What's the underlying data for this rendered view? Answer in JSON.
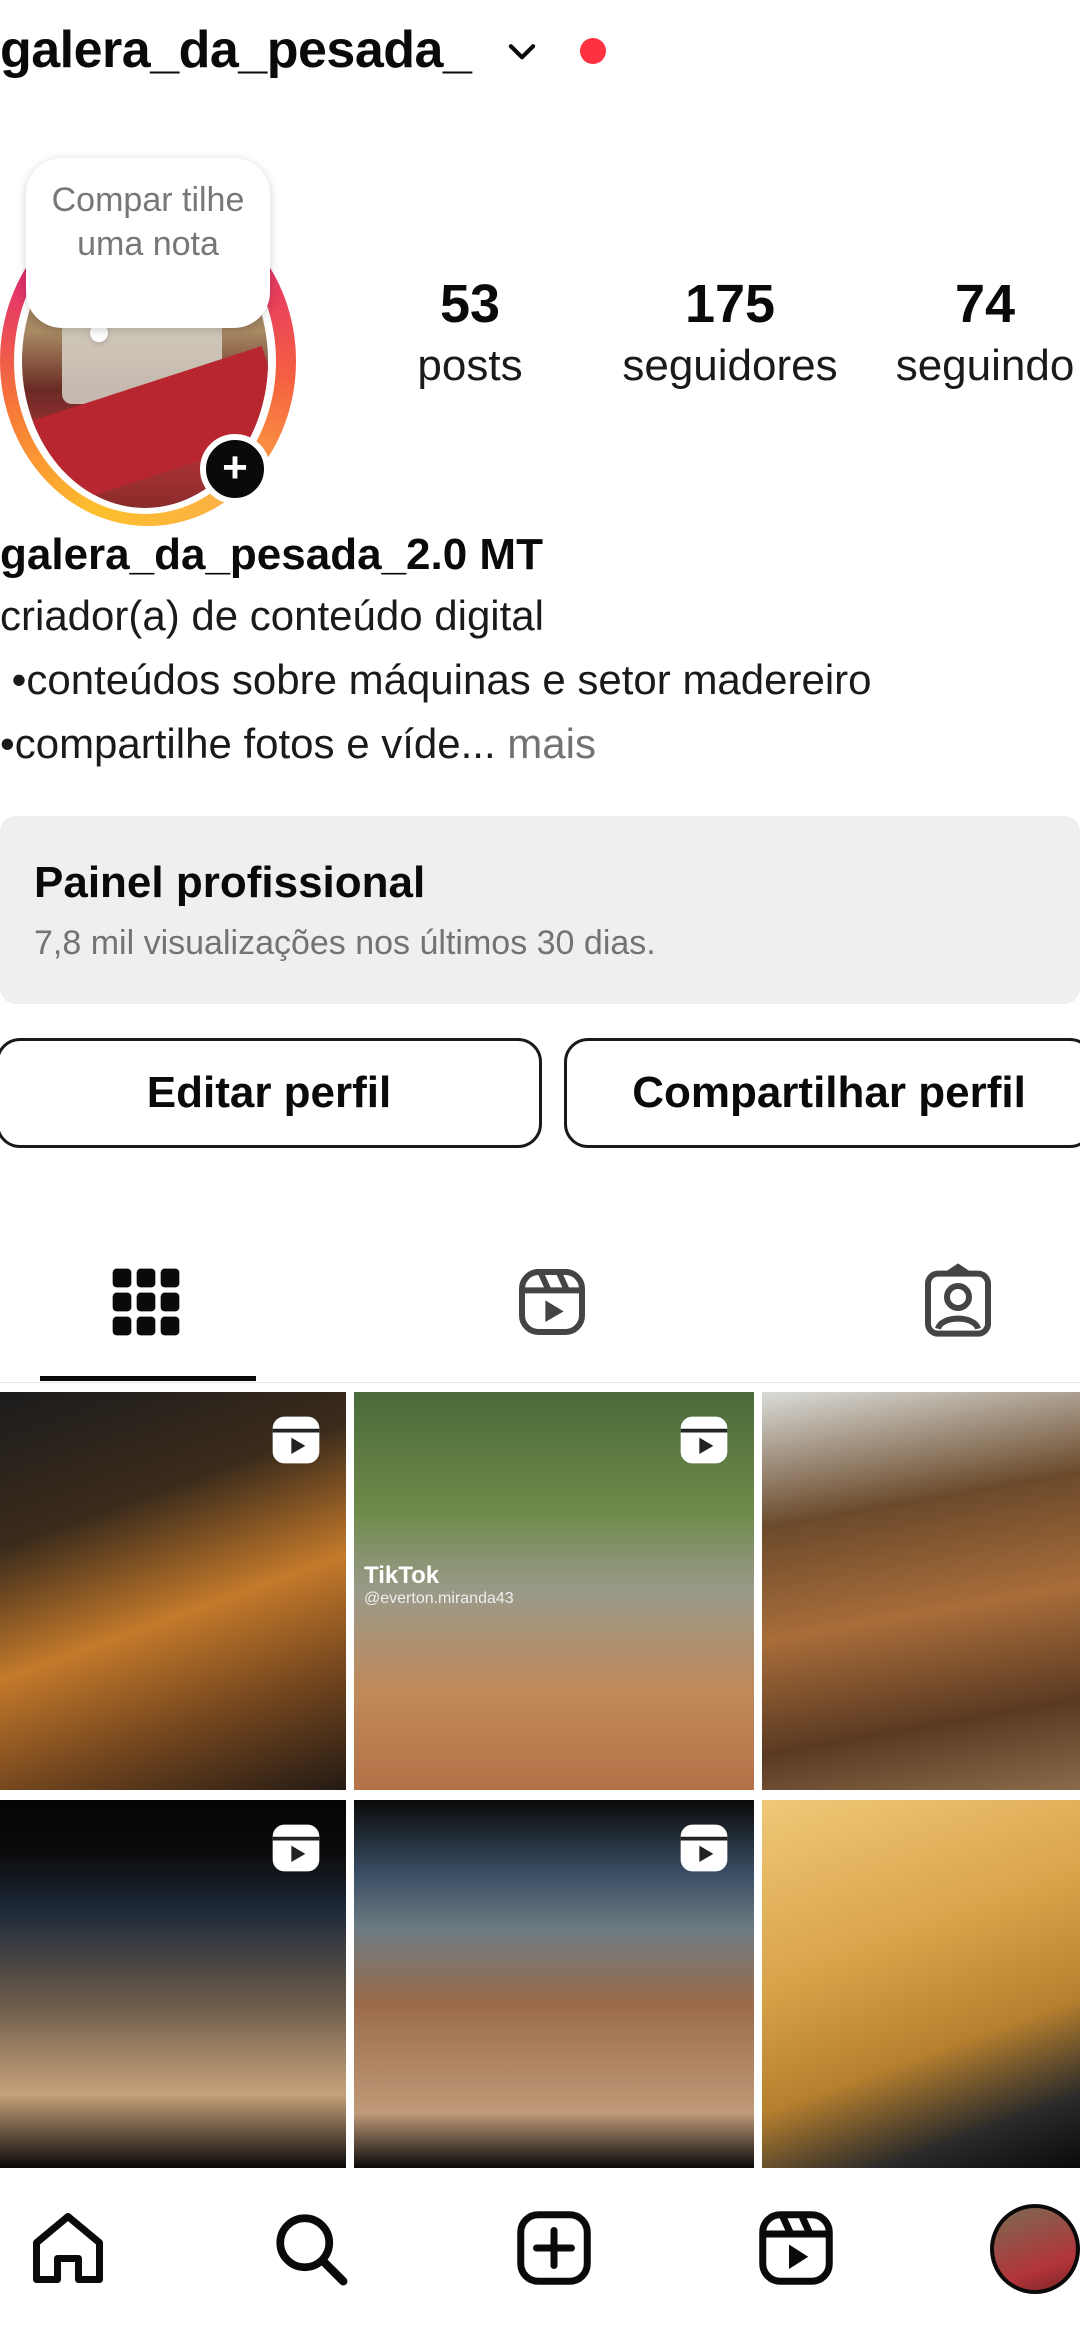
{
  "header": {
    "username": "galera_da_pesada_"
  },
  "note": {
    "text": "Compar tilhe uma nota"
  },
  "stats": [
    {
      "value": "53",
      "label": "posts"
    },
    {
      "value": "175",
      "label": "seguidores"
    },
    {
      "value": "74",
      "label": "seguindo"
    }
  ],
  "bio": {
    "name": "galera_da_pesada_2.0 MT",
    "category": "criador(a) de conteúdo digital",
    "line1": " •conteúdos sobre máquinas e setor madereiro",
    "line2": "•compartilhe fotos e víde...",
    "more": " mais"
  },
  "panel": {
    "title": "Painel profissional",
    "subtitle": "7,8 mil visualizações nos últimos 30 dias."
  },
  "buttons": {
    "edit": "Editar perfil",
    "share": "Compartilhar perfil"
  },
  "grid": {
    "post2_watermark": "TikTok",
    "post2_handle": "@everton.miranda43"
  },
  "colors": {
    "notification_dot": "#ff3040",
    "panel_bg": "#efeff0",
    "muted_text": "#737373"
  },
  "icons": {
    "tabs": [
      "grid-icon",
      "reels-icon",
      "tagged-icon"
    ],
    "nav": [
      "home-icon",
      "search-icon",
      "create-icon",
      "reels-icon",
      "profile-avatar"
    ]
  }
}
